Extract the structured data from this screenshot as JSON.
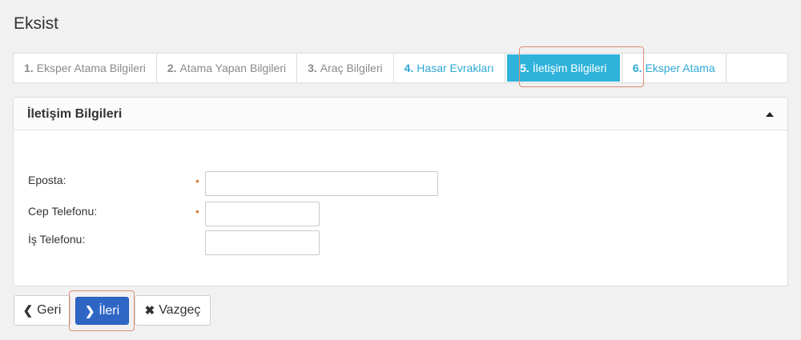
{
  "page": {
    "title": "Eksist"
  },
  "steps": [
    {
      "num": "1.",
      "label": "Eksper Atama Bilgileri",
      "state": "inactive"
    },
    {
      "num": "2.",
      "label": "Atama Yapan Bilgileri",
      "state": "inactive"
    },
    {
      "num": "3.",
      "label": "Araç Bilgileri",
      "state": "inactive"
    },
    {
      "num": "4.",
      "label": "Hasar Evrakları",
      "state": "link"
    },
    {
      "num": "5.",
      "label": "İletişim Bilgileri",
      "state": "active"
    },
    {
      "num": "6.",
      "label": "Eksper Atama",
      "state": "link"
    }
  ],
  "panel": {
    "title": "İletişim Bilgileri",
    "fields": [
      {
        "label": "Eposta:",
        "required": true,
        "value": "",
        "required_mark": "•"
      },
      {
        "label": "Cep Telefonu:",
        "required": true,
        "value": "",
        "required_mark": "•"
      },
      {
        "label": "İş Telefonu:",
        "required": false,
        "value": ""
      }
    ]
  },
  "buttons": {
    "back": {
      "icon": "chevron-left-icon",
      "label": "Geri"
    },
    "next": {
      "icon": "chevron-right-icon",
      "label": "İleri"
    },
    "cancel": {
      "icon": "x-icon",
      "label": "Vazgeç"
    }
  },
  "colors": {
    "active_tab": "#2fb3db",
    "link_tab": "#2fa8d5",
    "primary_button": "#2f66c6",
    "required_mark": "#d9803b",
    "highlight": "#e08a70"
  }
}
